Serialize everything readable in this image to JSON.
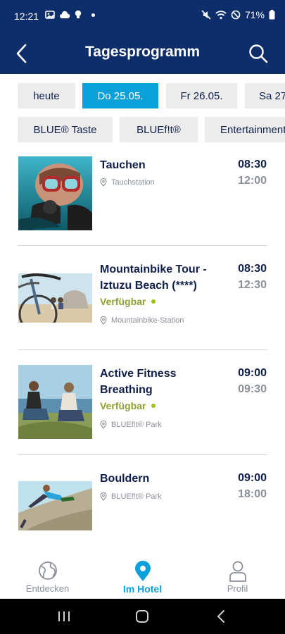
{
  "status": {
    "time": "12:21",
    "battery": "71%"
  },
  "header": {
    "title": "Tagesprogramm"
  },
  "days": [
    {
      "label": "heute",
      "active": false
    },
    {
      "label": "Do 25.05.",
      "active": true
    },
    {
      "label": "Fr 26.05.",
      "active": false
    },
    {
      "label": "Sa 27.",
      "active": false
    }
  ],
  "categories": [
    {
      "label": "BLUE® Taste"
    },
    {
      "label": "BLUEf!t®"
    },
    {
      "label": "Entertainment"
    }
  ],
  "activities": [
    {
      "title": "Tauchen",
      "availability": "",
      "location": "Tauchstation",
      "start": "08:30",
      "end": "12:00"
    },
    {
      "title": "Mountainbike Tour - Iztuzu Beach (****)",
      "availability": "Verfügbar",
      "location": "Mountainbike-Station",
      "start": "08:30",
      "end": "12:30"
    },
    {
      "title": "Active Fitness Breathing",
      "availability": "Verfügbar",
      "location": "BLUEf!t® Park",
      "start": "09:00",
      "end": "09:30"
    },
    {
      "title": "Bouldern",
      "availability": "",
      "location": "BLUEf!t® Park",
      "start": "09:00",
      "end": "18:00"
    }
  ],
  "nav": [
    {
      "label": "Entdecken",
      "icon": "globe-icon",
      "active": false
    },
    {
      "label": "Im Hotel",
      "icon": "location-pin-icon",
      "active": true
    },
    {
      "label": "Profil",
      "icon": "person-icon",
      "active": false
    }
  ],
  "colors": {
    "header": "#0e2d6b",
    "accent": "#0aa0db",
    "chip": "#ececec",
    "available": "#9cc21a"
  }
}
